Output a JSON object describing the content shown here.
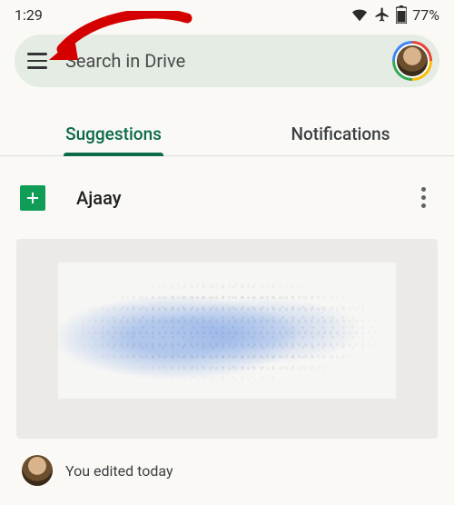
{
  "status": {
    "time": "1:29",
    "battery": "77%"
  },
  "search": {
    "placeholder": "Search in Drive"
  },
  "tabs": {
    "suggestions": "Suggestions",
    "notifications": "Notifications"
  },
  "file": {
    "name": "Ajaay",
    "edit_status": "You edited today"
  },
  "icons": {
    "hamburger": "menu-icon",
    "wifi": "wifi-icon",
    "airplane": "airplane-icon",
    "battery": "battery-icon",
    "avatar": "profile-avatar",
    "sheets": "sheets-icon",
    "more": "more-vert-icon"
  }
}
